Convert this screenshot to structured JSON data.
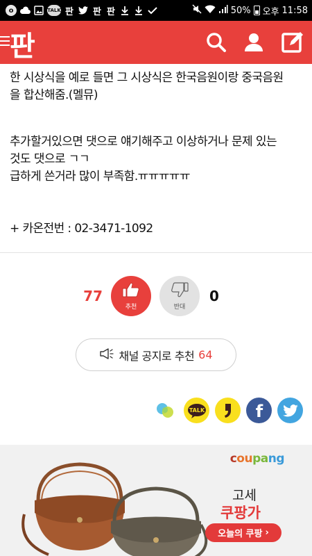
{
  "status_bar": {
    "battery": "50%",
    "time_prefix": "오후",
    "time": "11:58",
    "notification_icons": [
      "bubble-icon",
      "cloud-icon",
      "image-icon",
      "talk-icon",
      "pan-icon",
      "twitter-icon",
      "pan-icon",
      "pan-icon",
      "download-icon",
      "download-icon",
      "check-icon"
    ],
    "talk_label": "TALK",
    "pan_label": "판"
  },
  "header": {
    "logo_text": "판",
    "background_color": "#e8403c",
    "icons": [
      "search-icon",
      "user-icon",
      "write-icon"
    ]
  },
  "article": {
    "paragraphs": [
      [
        "한 시상식을 예로 들면 그 시상식은 한국음원이랑 중국음원",
        "을 합산해줌.(멜뮤)"
      ],
      [
        "추가할거있으면 댓으로 얘기해주고 이상하거나 문제 있는",
        "것도 댓으로 ㄱㄱ"
      ],
      [
        "급하게 쓴거라 많이 부족함.ㅠㅠㅠㅠㅠ"
      ],
      [
        "+ 카온전번 : 02-3471-1092"
      ]
    ]
  },
  "vote": {
    "up_count": "77",
    "up_label": "추천",
    "down_label": "반대",
    "down_count": "0"
  },
  "recommend": {
    "label": "채널 공지로 추천",
    "count": "64"
  },
  "share": [
    "channel-icon",
    "kakaotalk-icon",
    "kakaostory-icon",
    "facebook-icon",
    "twitter-icon"
  ],
  "share_labels": {
    "kakaotalk": "TALK",
    "facebook": "f"
  },
  "ad": {
    "brand_parts": [
      "c",
      "ou",
      "pa",
      "ng"
    ],
    "line1": "고세",
    "line2": "쿠팡가",
    "cta": "오늘의 쿠팡",
    "cta_arrow": "›"
  }
}
